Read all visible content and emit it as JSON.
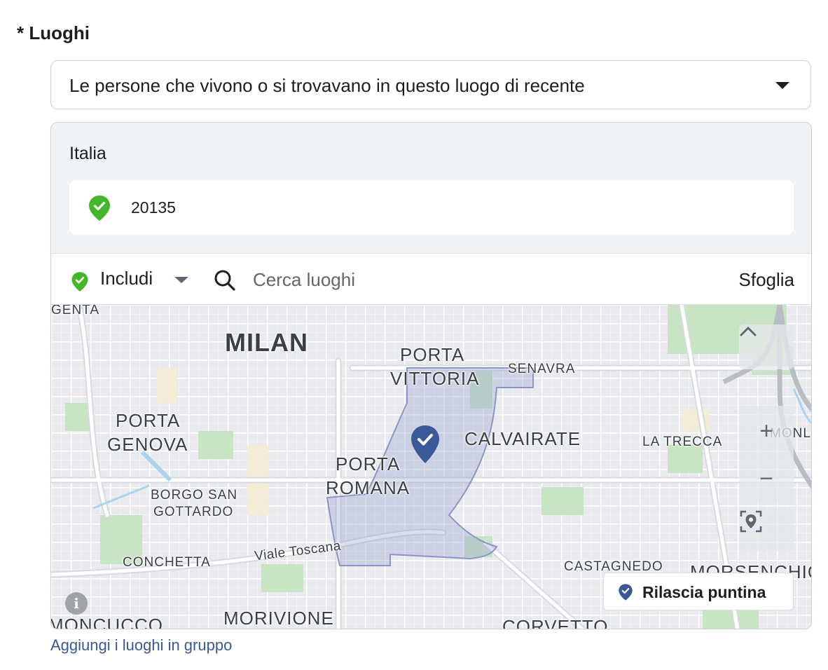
{
  "section": {
    "title": "* Luoghi"
  },
  "location_type": {
    "selected": "Le persone che vivono o si trovavano in questo luogo di recente"
  },
  "locations": {
    "country": "Italia",
    "items": [
      {
        "label": "20135",
        "icon": "check-pin-icon",
        "status_color": "#42b72a"
      }
    ]
  },
  "toolbar": {
    "include_label": "Includi",
    "search_placeholder": "Cerca luoghi",
    "browse_label": "Sfoglia"
  },
  "map": {
    "labels": {
      "milan": "MILAN",
      "porta_vittoria_1": "PORTA",
      "porta_vittoria_2": "VITTORIA",
      "senavra": "SENAVRA",
      "porta_genova_1": "PORTA",
      "porta_genova_2": "GENOVA",
      "calvairate": "CALVAIRATE",
      "la_trecca": "LA TRECCA",
      "monlue": "MONLU",
      "porta_romana_1": "PORTA",
      "porta_romana_2": "ROMANA",
      "borgo_1": "BORGO SAN",
      "borgo_2": "GOTTARDO",
      "viale_toscana": "Viale Toscana",
      "conchetta": "CONCHETTA",
      "castagnedo": "CASTAGNEDO",
      "morsenchio": "MORSENCHIO",
      "moncucco": "MONCUCCO",
      "morivione": "MORIVIONE",
      "corvetto": "CORVETTO",
      "genta": "GENTA"
    },
    "zoom_in": "+",
    "zoom_out": "−",
    "drop_pin_label": "Rilascia puntina",
    "accent_color": "#3b5998"
  },
  "footer": {
    "bulk_link": "Aggiungi i luoghi in gruppo"
  }
}
